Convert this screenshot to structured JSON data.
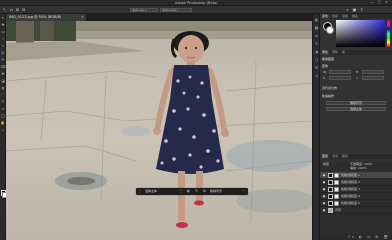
{
  "app": {
    "title": "Adobe Photoshop (Beta)"
  },
  "window_controls": {
    "minimize": "—",
    "maximize": "▢",
    "close": "✕"
  },
  "options_bar": {
    "tool_label": "↖",
    "sample_field": "选择主体 ▾",
    "mode_field": "选择并遮住..."
  },
  "document_tab": {
    "label": "IMG_0123.jpg @ 50% (RGB/8)",
    "close": "×"
  },
  "tools": [
    "↖",
    "✥",
    "▭",
    "⌁",
    "⌖",
    "⊡",
    "✎",
    "⌫",
    "✤",
    "◪",
    "◍",
    "⬚",
    "T",
    "↗",
    "◯",
    "✋",
    "⌕"
  ],
  "context_bar": {
    "left_label": "选择主体",
    "middle_label": "移除背景",
    "right_label": "更多选项"
  },
  "icon_strip": [
    "◐",
    "▦",
    "≡",
    "✎",
    "◑",
    "⬡",
    "☰",
    "◎"
  ],
  "color_panel": {
    "tabs": [
      "颜色",
      "色板",
      "渐变",
      "图案"
    ]
  },
  "properties": {
    "tabs": [
      "属性",
      "调整",
      "库"
    ],
    "section_1": "像素图层",
    "section_2": "变换",
    "w_label": "W",
    "h_label": "H",
    "x_label": "X",
    "y_label": "Y",
    "section_3": "对齐并分布",
    "section_4": "快速操作",
    "btn_1": "删除背景",
    "btn_2": "选择主体"
  },
  "layers_panel": {
    "tabs": [
      "图层",
      "通道",
      "路径"
    ],
    "kind_label": "类型",
    "opacity_label": "不透明度: 100%",
    "fill_label": "填充: 100%",
    "layers": [
      {
        "name": "色相/饱和度 1",
        "visible": "●"
      },
      {
        "name": "色相/饱和度 2",
        "visible": "●"
      },
      {
        "name": "色相/饱和度 3",
        "visible": "●"
      },
      {
        "name": "色相/饱和度 4",
        "visible": "●"
      },
      {
        "name": "色相/饱和度 5",
        "visible": "●"
      },
      {
        "name": "背景",
        "visible": "●"
      }
    ],
    "footer_icons": "fx ◐ ▭ ⊞ 🗑"
  },
  "colors": {
    "accent": "#2f2ad8",
    "panel": "#323232",
    "selected_layer": "#484848"
  }
}
